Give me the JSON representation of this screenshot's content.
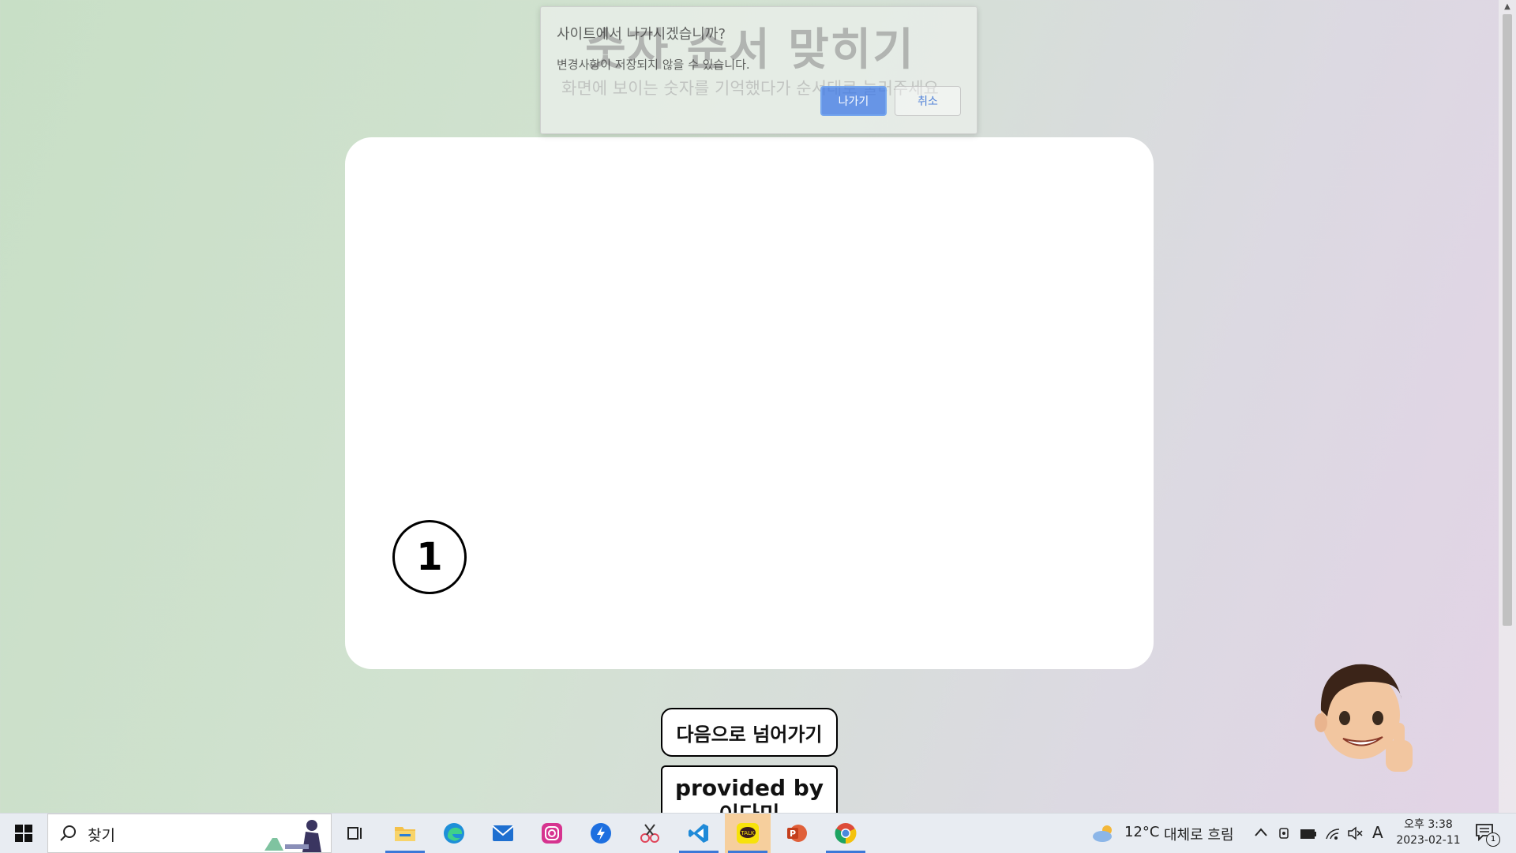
{
  "page": {
    "title": "숫자 순서 맞히기",
    "subtitle": "화면에 보이는 숫자를 기억했다가 순서대로 눌러주세요",
    "circle_number": "1",
    "next_button": "다음으로 넘어가기",
    "credit_button": "provided by 이다미"
  },
  "dialog": {
    "title": "사이트에서 나가시겠습니까?",
    "message": "변경사항이 저장되지 않을 수 있습니다.",
    "ok_label": "나가기",
    "cancel_label": "취소"
  },
  "taskbar": {
    "search_placeholder": "찾기",
    "weather_temp": "12°C",
    "weather_desc": "대체로 흐림",
    "ime": "A",
    "time": "오후 3:38",
    "date": "2023-02-11",
    "notification_count": "1",
    "apps": [
      "task-view",
      "file-explorer",
      "edge",
      "mail",
      "instagram",
      "app-blue",
      "snipping-tool",
      "vscode",
      "kakaotalk",
      "powerpoint",
      "chrome"
    ]
  }
}
